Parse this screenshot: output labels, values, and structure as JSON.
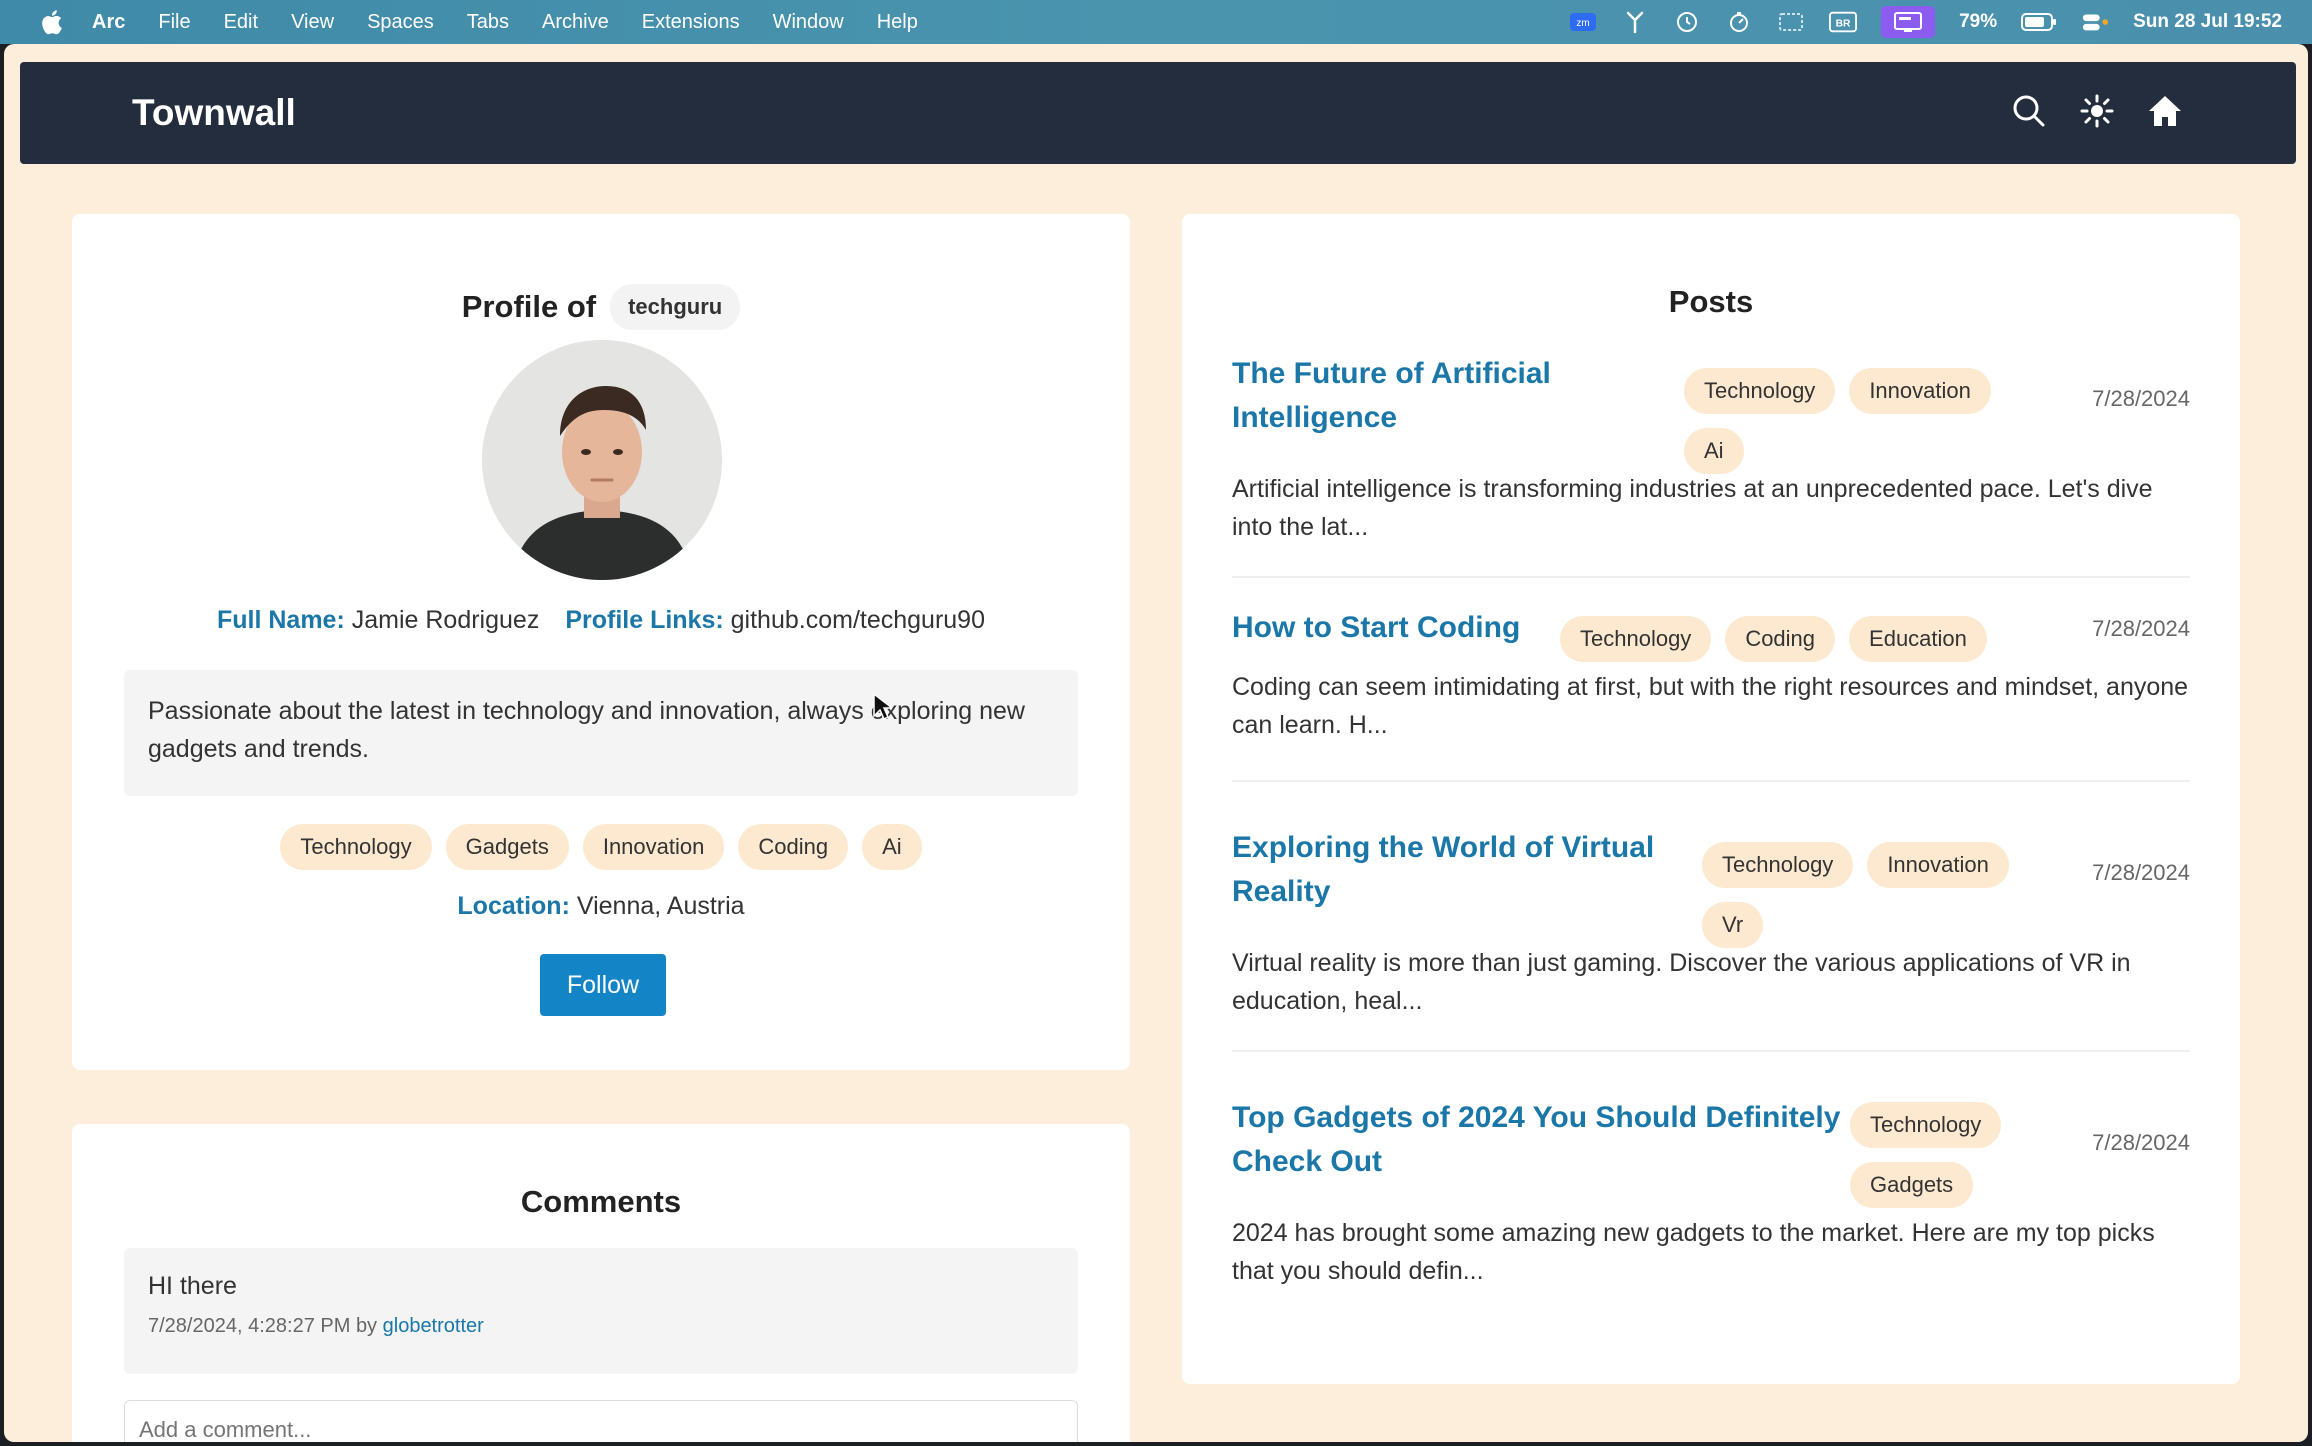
{
  "menubar": {
    "items": [
      "Arc",
      "File",
      "Edit",
      "View",
      "Spaces",
      "Tabs",
      "Archive",
      "Extensions",
      "Window",
      "Help"
    ],
    "battery": "79%",
    "datetime": "Sun 28 Jul  19:52",
    "icons": [
      "apple-icon",
      "zoom-icon",
      "network-icon",
      "time-machine-icon",
      "timer-icon",
      "screen-icon",
      "keyboard-icon",
      "display-icon",
      "battery-icon",
      "control-center-icon"
    ]
  },
  "header": {
    "brand": "Townwall",
    "icons": [
      "search-icon",
      "sun-icon",
      "home-icon"
    ]
  },
  "profile": {
    "title": "Profile of",
    "username": "techguru",
    "full_name_label": "Full Name:",
    "full_name": "Jamie Rodriguez",
    "links_label": "Profile Links:",
    "links": "github.com/techguru90",
    "bio": "Passionate about the latest in technology and innovation, always exploring new gadgets and trends.",
    "tags": [
      "Technology",
      "Gadgets",
      "Innovation",
      "Coding",
      "Ai"
    ],
    "location_label": "Location:",
    "location": "Vienna, Austria",
    "follow_label": "Follow"
  },
  "comments": {
    "title": "Comments",
    "items": [
      {
        "text": "HI there",
        "timestamp": "7/28/2024, 4:28:27 PM",
        "by": "by",
        "author": "globetrotter"
      }
    ],
    "placeholder": "Add a comment..."
  },
  "posts": {
    "title": "Posts",
    "items": [
      {
        "title_line1": "The Future of Artificial",
        "title_line2": "Intelligence",
        "tags": [
          "Technology",
          "Innovation",
          "Ai"
        ],
        "date": "7/28/2024",
        "excerpt": "Artificial intelligence is transforming industries at an unprecedented pace. Let's dive into the lat..."
      },
      {
        "title_line1": "How to Start Coding",
        "title_line2": "",
        "tags": [
          "Technology",
          "Coding",
          "Education"
        ],
        "date": "7/28/2024",
        "excerpt": "Coding can seem intimidating at first, but with the right resources and mindset, anyone can learn. H..."
      },
      {
        "title_line1": "Exploring the World of Virtual",
        "title_line2": "Reality",
        "tags": [
          "Technology",
          "Innovation",
          "Vr"
        ],
        "date": "7/28/2024",
        "excerpt": "Virtual reality is more than just gaming. Discover the various applications of VR in education, heal..."
      },
      {
        "title_line1": "Top Gadgets of 2024 You Should Definitely",
        "title_line2": "Check Out",
        "tags": [
          "Technology",
          "Gadgets"
        ],
        "date": "7/28/2024",
        "excerpt": "2024 has brought some amazing new gadgets to the market. Here are my top picks that you should defin..."
      }
    ]
  },
  "colors": {
    "accent": "#1a77a8",
    "button": "#1384c6",
    "page_bg": "#fdeedc",
    "header_bg": "#232d3d",
    "tag_bg": "#fde9d0"
  }
}
